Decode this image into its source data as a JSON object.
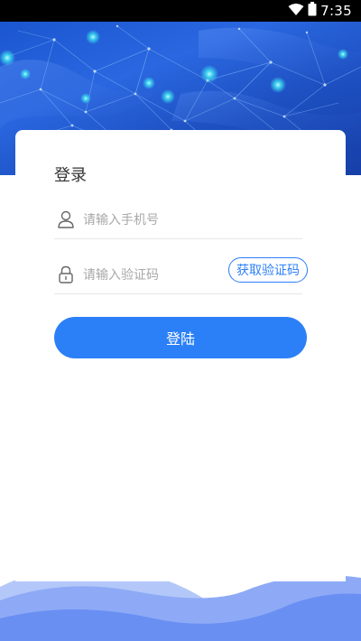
{
  "status_bar": {
    "time": "7:35",
    "icons": [
      "wifi-icon",
      "battery-icon"
    ]
  },
  "login": {
    "title": "登录",
    "phone": {
      "icon": "user-icon",
      "placeholder": "请输入手机号",
      "value": ""
    },
    "code": {
      "icon": "lock-icon",
      "placeholder": "请输入验证码",
      "value": "",
      "button_label": "获取验证码"
    },
    "submit_label": "登陆"
  },
  "colors": {
    "accent": "#2b80f7",
    "banner": "#1d56c8",
    "wave_light": "#a9c0f8",
    "wave_mid": "#7f9ff5",
    "wave_dark": "#5f86f2"
  }
}
